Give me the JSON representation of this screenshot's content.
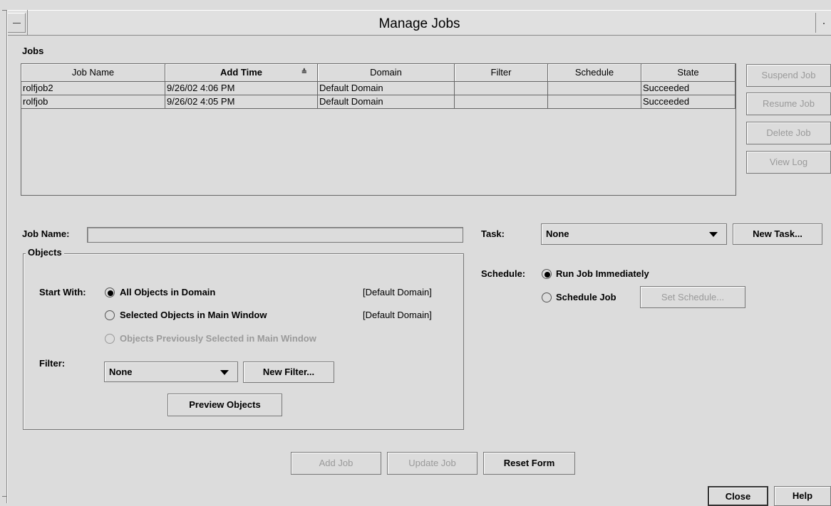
{
  "window": {
    "title": "Manage Jobs"
  },
  "jobs_label": "Jobs",
  "table": {
    "columns": [
      {
        "label": "Job Name",
        "sorted": false
      },
      {
        "label": "Add Time",
        "sorted": true
      },
      {
        "label": "Domain",
        "sorted": false
      },
      {
        "label": "Filter",
        "sorted": false
      },
      {
        "label": "Schedule",
        "sorted": false
      },
      {
        "label": "State",
        "sorted": false
      }
    ],
    "sort_indicator": "≙",
    "rows": [
      [
        "rolfjob2",
        "9/26/02 4:06 PM",
        "Default Domain",
        "",
        "",
        "Succeeded"
      ],
      [
        "rolfjob",
        "9/26/02 4:05 PM",
        "Default Domain",
        "",
        "",
        "Succeeded"
      ]
    ]
  },
  "side_buttons": {
    "suspend": "Suspend Job",
    "resume": "Resume Job",
    "delete": "Delete Job",
    "view_log": "View Log"
  },
  "form": {
    "job_name_label": "Job Name:",
    "job_name_value": "",
    "objects_group": "Objects",
    "start_with_label": "Start With:",
    "opt_all": "All Objects in Domain",
    "opt_all_domain": "[Default Domain]",
    "opt_selected": "Selected Objects in Main Window",
    "opt_selected_domain": "[Default Domain]",
    "opt_previous": "Objects Previously Selected in Main Window",
    "filter_label": "Filter:",
    "filter_value": "None",
    "new_filter": "New Filter...",
    "preview": "Preview Objects",
    "task_label": "Task:",
    "task_value": "None",
    "new_task": "New Task...",
    "schedule_label": "Schedule:",
    "run_immediately": "Run Job Immediately",
    "schedule_job": "Schedule Job",
    "set_schedule": "Set Schedule..."
  },
  "bottom": {
    "add_job": "Add Job",
    "update_job": "Update Job",
    "reset_form": "Reset Form",
    "close": "Close",
    "help": "Help"
  }
}
